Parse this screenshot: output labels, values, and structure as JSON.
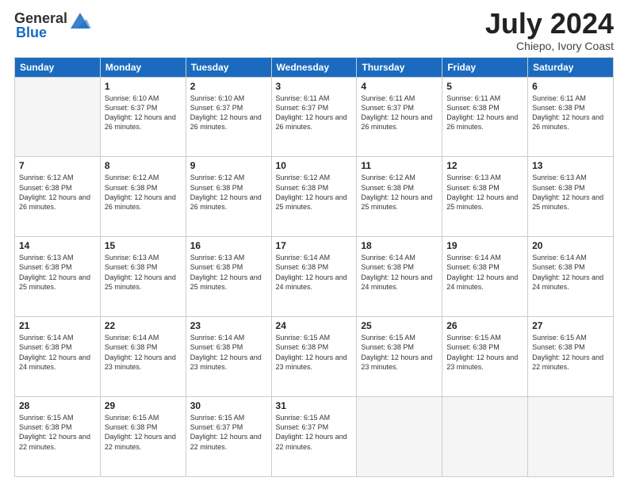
{
  "header": {
    "logo_general": "General",
    "logo_blue": "Blue",
    "title": "July 2024",
    "location": "Chiepo, Ivory Coast"
  },
  "days_of_week": [
    "Sunday",
    "Monday",
    "Tuesday",
    "Wednesday",
    "Thursday",
    "Friday",
    "Saturday"
  ],
  "weeks": [
    [
      {
        "num": "",
        "sunrise": "",
        "sunset": "",
        "daylight": "",
        "empty": true
      },
      {
        "num": "1",
        "sunrise": "Sunrise: 6:10 AM",
        "sunset": "Sunset: 6:37 PM",
        "daylight": "Daylight: 12 hours and 26 minutes."
      },
      {
        "num": "2",
        "sunrise": "Sunrise: 6:10 AM",
        "sunset": "Sunset: 6:37 PM",
        "daylight": "Daylight: 12 hours and 26 minutes."
      },
      {
        "num": "3",
        "sunrise": "Sunrise: 6:11 AM",
        "sunset": "Sunset: 6:37 PM",
        "daylight": "Daylight: 12 hours and 26 minutes."
      },
      {
        "num": "4",
        "sunrise": "Sunrise: 6:11 AM",
        "sunset": "Sunset: 6:37 PM",
        "daylight": "Daylight: 12 hours and 26 minutes."
      },
      {
        "num": "5",
        "sunrise": "Sunrise: 6:11 AM",
        "sunset": "Sunset: 6:38 PM",
        "daylight": "Daylight: 12 hours and 26 minutes."
      },
      {
        "num": "6",
        "sunrise": "Sunrise: 6:11 AM",
        "sunset": "Sunset: 6:38 PM",
        "daylight": "Daylight: 12 hours and 26 minutes."
      }
    ],
    [
      {
        "num": "7",
        "sunrise": "Sunrise: 6:12 AM",
        "sunset": "Sunset: 6:38 PM",
        "daylight": "Daylight: 12 hours and 26 minutes."
      },
      {
        "num": "8",
        "sunrise": "Sunrise: 6:12 AM",
        "sunset": "Sunset: 6:38 PM",
        "daylight": "Daylight: 12 hours and 26 minutes."
      },
      {
        "num": "9",
        "sunrise": "Sunrise: 6:12 AM",
        "sunset": "Sunset: 6:38 PM",
        "daylight": "Daylight: 12 hours and 26 minutes."
      },
      {
        "num": "10",
        "sunrise": "Sunrise: 6:12 AM",
        "sunset": "Sunset: 6:38 PM",
        "daylight": "Daylight: 12 hours and 25 minutes."
      },
      {
        "num": "11",
        "sunrise": "Sunrise: 6:12 AM",
        "sunset": "Sunset: 6:38 PM",
        "daylight": "Daylight: 12 hours and 25 minutes."
      },
      {
        "num": "12",
        "sunrise": "Sunrise: 6:13 AM",
        "sunset": "Sunset: 6:38 PM",
        "daylight": "Daylight: 12 hours and 25 minutes."
      },
      {
        "num": "13",
        "sunrise": "Sunrise: 6:13 AM",
        "sunset": "Sunset: 6:38 PM",
        "daylight": "Daylight: 12 hours and 25 minutes."
      }
    ],
    [
      {
        "num": "14",
        "sunrise": "Sunrise: 6:13 AM",
        "sunset": "Sunset: 6:38 PM",
        "daylight": "Daylight: 12 hours and 25 minutes."
      },
      {
        "num": "15",
        "sunrise": "Sunrise: 6:13 AM",
        "sunset": "Sunset: 6:38 PM",
        "daylight": "Daylight: 12 hours and 25 minutes."
      },
      {
        "num": "16",
        "sunrise": "Sunrise: 6:13 AM",
        "sunset": "Sunset: 6:38 PM",
        "daylight": "Daylight: 12 hours and 25 minutes."
      },
      {
        "num": "17",
        "sunrise": "Sunrise: 6:14 AM",
        "sunset": "Sunset: 6:38 PM",
        "daylight": "Daylight: 12 hours and 24 minutes."
      },
      {
        "num": "18",
        "sunrise": "Sunrise: 6:14 AM",
        "sunset": "Sunset: 6:38 PM",
        "daylight": "Daylight: 12 hours and 24 minutes."
      },
      {
        "num": "19",
        "sunrise": "Sunrise: 6:14 AM",
        "sunset": "Sunset: 6:38 PM",
        "daylight": "Daylight: 12 hours and 24 minutes."
      },
      {
        "num": "20",
        "sunrise": "Sunrise: 6:14 AM",
        "sunset": "Sunset: 6:38 PM",
        "daylight": "Daylight: 12 hours and 24 minutes."
      }
    ],
    [
      {
        "num": "21",
        "sunrise": "Sunrise: 6:14 AM",
        "sunset": "Sunset: 6:38 PM",
        "daylight": "Daylight: 12 hours and 24 minutes."
      },
      {
        "num": "22",
        "sunrise": "Sunrise: 6:14 AM",
        "sunset": "Sunset: 6:38 PM",
        "daylight": "Daylight: 12 hours and 23 minutes."
      },
      {
        "num": "23",
        "sunrise": "Sunrise: 6:14 AM",
        "sunset": "Sunset: 6:38 PM",
        "daylight": "Daylight: 12 hours and 23 minutes."
      },
      {
        "num": "24",
        "sunrise": "Sunrise: 6:15 AM",
        "sunset": "Sunset: 6:38 PM",
        "daylight": "Daylight: 12 hours and 23 minutes."
      },
      {
        "num": "25",
        "sunrise": "Sunrise: 6:15 AM",
        "sunset": "Sunset: 6:38 PM",
        "daylight": "Daylight: 12 hours and 23 minutes."
      },
      {
        "num": "26",
        "sunrise": "Sunrise: 6:15 AM",
        "sunset": "Sunset: 6:38 PM",
        "daylight": "Daylight: 12 hours and 23 minutes."
      },
      {
        "num": "27",
        "sunrise": "Sunrise: 6:15 AM",
        "sunset": "Sunset: 6:38 PM",
        "daylight": "Daylight: 12 hours and 22 minutes."
      }
    ],
    [
      {
        "num": "28",
        "sunrise": "Sunrise: 6:15 AM",
        "sunset": "Sunset: 6:38 PM",
        "daylight": "Daylight: 12 hours and 22 minutes."
      },
      {
        "num": "29",
        "sunrise": "Sunrise: 6:15 AM",
        "sunset": "Sunset: 6:38 PM",
        "daylight": "Daylight: 12 hours and 22 minutes."
      },
      {
        "num": "30",
        "sunrise": "Sunrise: 6:15 AM",
        "sunset": "Sunset: 6:37 PM",
        "daylight": "Daylight: 12 hours and 22 minutes."
      },
      {
        "num": "31",
        "sunrise": "Sunrise: 6:15 AM",
        "sunset": "Sunset: 6:37 PM",
        "daylight": "Daylight: 12 hours and 22 minutes."
      },
      {
        "num": "",
        "sunrise": "",
        "sunset": "",
        "daylight": "",
        "empty": true
      },
      {
        "num": "",
        "sunrise": "",
        "sunset": "",
        "daylight": "",
        "empty": true
      },
      {
        "num": "",
        "sunrise": "",
        "sunset": "",
        "daylight": "",
        "empty": true
      }
    ]
  ]
}
